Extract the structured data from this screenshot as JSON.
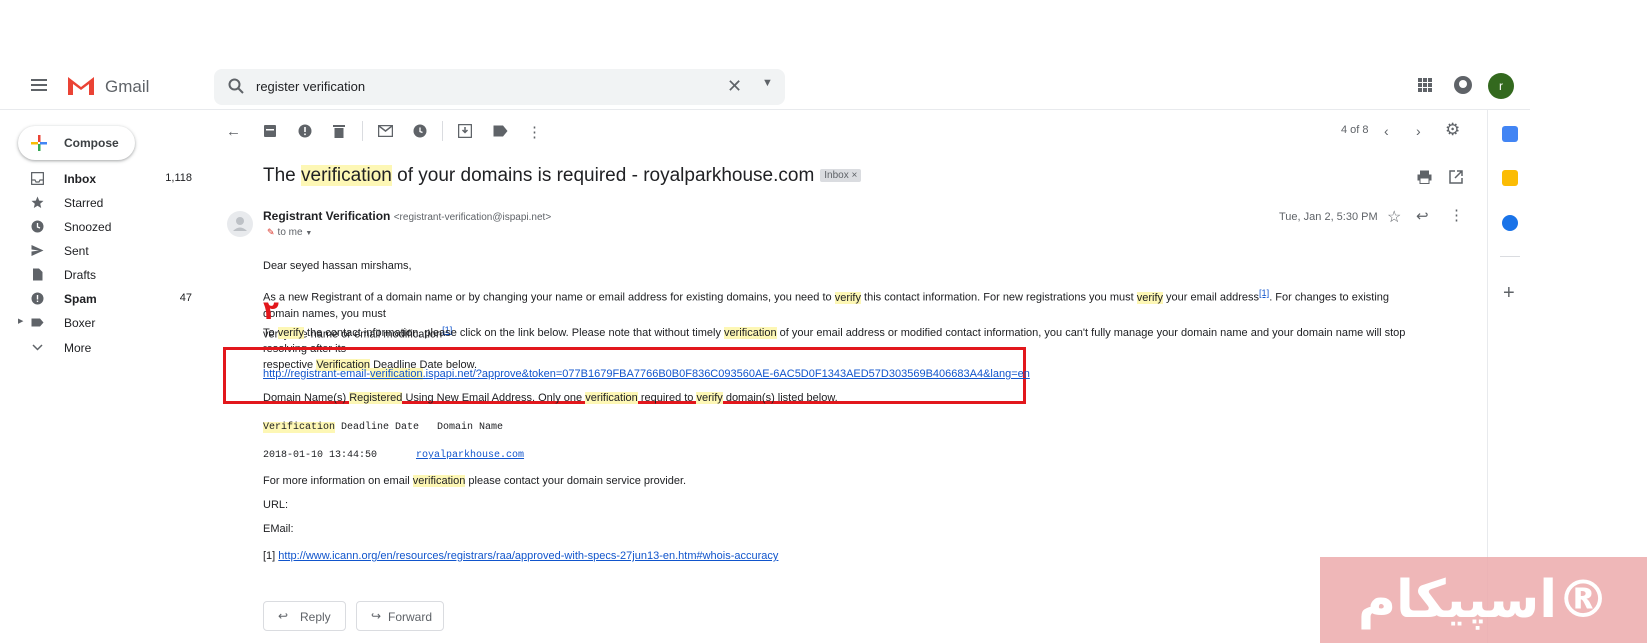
{
  "header": {
    "app_name": "Gmail",
    "search_value": "register verification",
    "avatar_letter": "r"
  },
  "compose_label": "Compose",
  "nav": [
    {
      "label": "Inbox",
      "count": "1,118",
      "icon": "inbox-icon",
      "bold": true
    },
    {
      "label": "Starred",
      "count": "",
      "icon": "star-icon",
      "bold": false
    },
    {
      "label": "Snoozed",
      "count": "",
      "icon": "clock-icon",
      "bold": false
    },
    {
      "label": "Sent",
      "count": "",
      "icon": "send-icon",
      "bold": false
    },
    {
      "label": "Drafts",
      "count": "",
      "icon": "draft-icon",
      "bold": false
    },
    {
      "label": "Spam",
      "count": "47",
      "icon": "spam-icon",
      "bold": true
    },
    {
      "label": "Boxer",
      "count": "",
      "icon": "label-icon",
      "bold": false
    },
    {
      "label": "More",
      "count": "",
      "icon": "chevron-down-icon",
      "bold": false
    }
  ],
  "pager": "4 of 8",
  "message": {
    "subject_pre": "The ",
    "subject_hl": "verification",
    "subject_post": " of your domains is required - royalparkhouse.com",
    "label_badge": "Inbox ×",
    "sender_name": "Registrant Verification",
    "sender_email": "<registrant-verification@ispapi.net>",
    "to": "to me",
    "date": "Tue, Jan 2, 5:30 PM",
    "greeting": "Dear seyed hassan mirshams,",
    "p1_a": "As a new Registrant of a domain name or by changing your name or email address for existing domains, you need to ",
    "p1_hl1": "verify",
    "p1_b": " this contact information. For new registrations you must ",
    "p1_hl2": "verify",
    "p1_c": " your email address",
    "p1_ref1": "[1]",
    "p1_d": ". For changes to existing domain names, you must",
    "p1_line2": "verify the name or email modification",
    "p1_ref2": "[1]",
    "p2_a": "To ",
    "p2_hl1": "verify",
    "p2_b": " the contact information, please click on the link below. Please note that without timely ",
    "p2_hl2": "verification",
    "p2_c": " of your email address or modified contact information, you can't fully manage your domain name and your domain name will stop resolving after its",
    "p2_d": "respective ",
    "p2_hl3": "Verification",
    "p2_e": " Deadline Date below.",
    "link_a": "http://registrant-email-",
    "link_hl": "verification",
    "link_b": ".ispapi.net/?approve&token=077B1679FBA7766B0B0F836C093560AE-6AC5D0F1343AED57D303569B406683A4&lang=en",
    "p3_a": "Domain Name(s) ",
    "p3_hl1": "Registered",
    "p3_b": " Using New Email Address. Only one ",
    "p3_hl2": "verification",
    "p3_c": " required to ",
    "p3_hl3": "verify",
    "p3_d": " domain(s) listed below.",
    "table_h_hl": "Verification",
    "table_h_rest": " Deadline Date   Domain Name",
    "table_date": "2018-01-10 13:44:50",
    "table_domain": "royalparkhouse.com",
    "p4_a": "For more information on email ",
    "p4_hl": "verification",
    "p4_b": " please contact your domain service provider.",
    "url_label": "URL:",
    "email_label": "EMail:",
    "ref_prefix": "[1] ",
    "ref_link": "http://www.icann.org/en/resources/registrars/raa/approved-with-specs-27jun13-en.htm#whois-accuracy"
  },
  "annotation_mark": "۲",
  "reply_label": "Reply",
  "forward_label": "Forward",
  "watermark": "اسپیکام®",
  "colors": {
    "highlight": "#fdf7b5",
    "annotation": "#e2171c",
    "link": "#1155cc"
  }
}
